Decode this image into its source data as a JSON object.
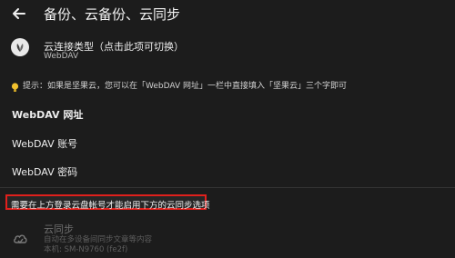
{
  "header": {
    "title": "备份、云备份、云同步"
  },
  "cloud_type": {
    "title": "云连接类型（点击此项可切换）",
    "value": "WebDAV"
  },
  "hint": "提示：如果是坚果云，您可以在「WebDAV 网址」一栏中直接填入「坚果云」三个字即可",
  "fields": [
    {
      "label": "WebDAV 网址"
    },
    {
      "label": "WebDAV 账号"
    },
    {
      "label": "WebDAV 密码"
    }
  ],
  "warning": "需要在上方登录云盘帐号才能启用下方的云同步选项",
  "sync": {
    "title": "云同步",
    "description": "自动在多设备间同步文章等内容",
    "device": "本机: SM-N9760 (fe2f)"
  },
  "colors": {
    "warning_border": "#e0201c",
    "background": "#1c1c1c"
  }
}
